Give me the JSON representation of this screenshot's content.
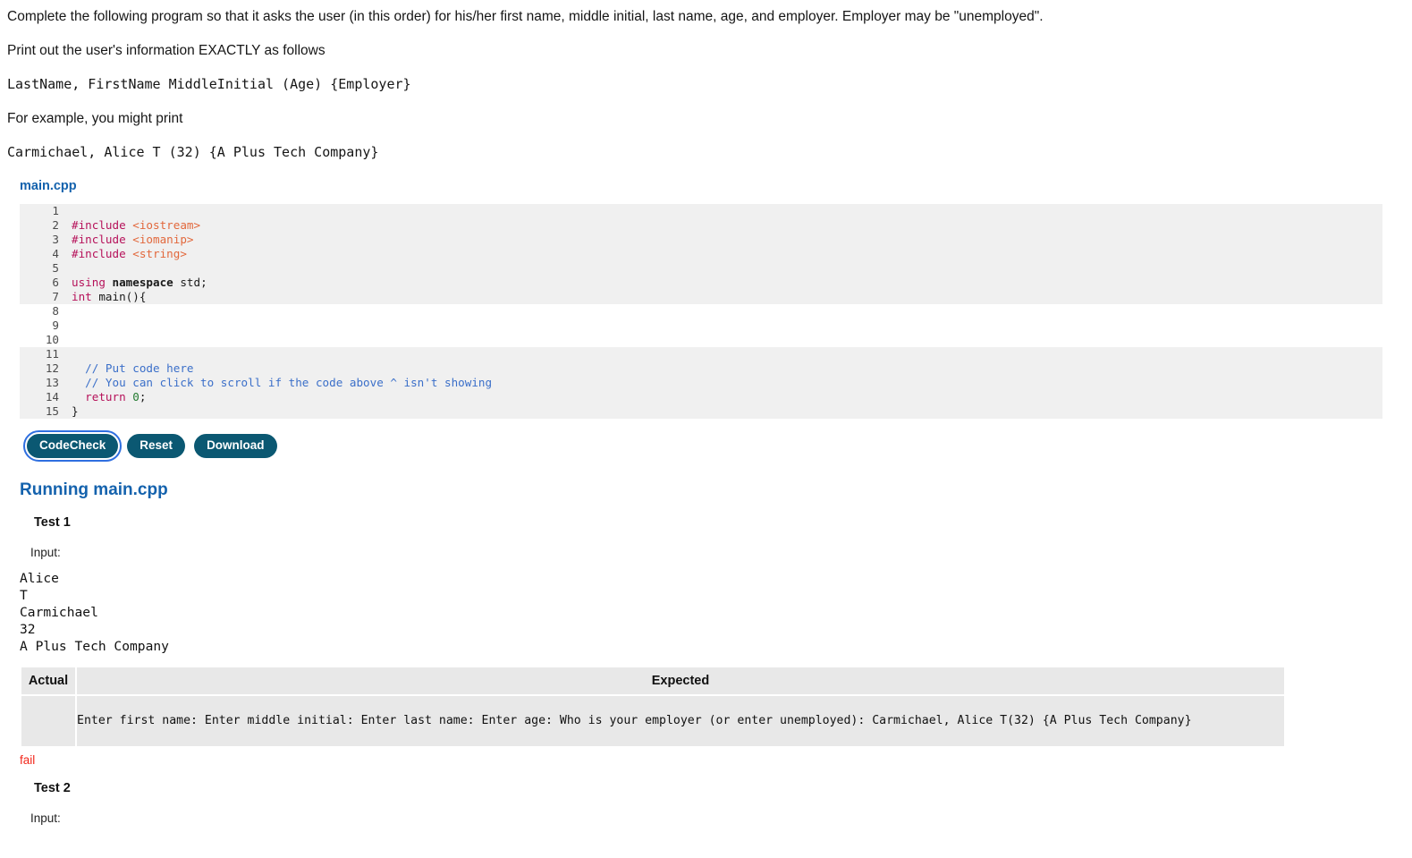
{
  "problem": {
    "lines": [
      {
        "text": "Complete the following program so that it asks the user (in this order) for his/her first name, middle initial, last name, age, and employer. Employer may be \"unemployed\".",
        "mono": false
      },
      {
        "text": "Print out the user's information EXACTLY as follows",
        "mono": false
      },
      {
        "text": "LastName, FirstName MiddleInitial (Age) {Employer}",
        "mono": true
      },
      {
        "text": "For example, you might print",
        "mono": false
      },
      {
        "text": "Carmichael, Alice T (32) {A Plus Tech Company}",
        "mono": true
      }
    ]
  },
  "editor": {
    "filename": "main.cpp",
    "segments": [
      {
        "editable": false,
        "lines": [
          {
            "n": "1",
            "tokens": []
          },
          {
            "n": "2",
            "tokens": [
              {
                "t": "#include ",
                "c": "pre"
              },
              {
                "t": "<iostream>",
                "c": "inc"
              }
            ]
          },
          {
            "n": "3",
            "tokens": [
              {
                "t": "#include ",
                "c": "pre"
              },
              {
                "t": "<iomanip>",
                "c": "inc"
              }
            ]
          },
          {
            "n": "4",
            "tokens": [
              {
                "t": "#include ",
                "c": "pre"
              },
              {
                "t": "<string>",
                "c": "inc"
              }
            ]
          },
          {
            "n": "5",
            "tokens": []
          },
          {
            "n": "6",
            "tokens": [
              {
                "t": "using ",
                "c": "kw"
              },
              {
                "t": "namespace",
                "c": "bold"
              },
              {
                "t": " std;",
                "c": "plain"
              }
            ]
          },
          {
            "n": "7",
            "tokens": [
              {
                "t": "int",
                "c": "kw"
              },
              {
                "t": " main(){",
                "c": "plain"
              }
            ]
          }
        ]
      },
      {
        "editable": true,
        "lines": [
          {
            "n": "8",
            "tokens": []
          },
          {
            "n": "9",
            "tokens": []
          },
          {
            "n": "10",
            "tokens": []
          }
        ]
      },
      {
        "editable": false,
        "lines": [
          {
            "n": "11",
            "tokens": []
          },
          {
            "n": "12",
            "tokens": [
              {
                "t": "  // Put code here",
                "c": "com"
              }
            ]
          },
          {
            "n": "13",
            "tokens": [
              {
                "t": "  // You can click to scroll if the code above ^ isn't showing",
                "c": "com"
              }
            ]
          },
          {
            "n": "14",
            "tokens": [
              {
                "t": "  return",
                "c": "kw"
              },
              {
                "t": " ",
                "c": "plain"
              },
              {
                "t": "0",
                "c": "num"
              },
              {
                "t": ";",
                "c": "plain"
              }
            ]
          },
          {
            "n": "15",
            "tokens": [
              {
                "t": "}",
                "c": "plain"
              }
            ]
          }
        ]
      }
    ]
  },
  "toolbar": {
    "codecheck_label": "CodeCheck",
    "reset_label": "Reset",
    "download_label": "Download"
  },
  "results": {
    "run_title": "Running main.cpp",
    "input_label": "Input:",
    "columns": {
      "actual": "Actual",
      "expected": "Expected"
    },
    "tests": [
      {
        "name": "Test 1",
        "input": "Alice\nT\nCarmichael\n32\nA Plus Tech Company",
        "actual": "",
        "expected": "Enter first name: Enter middle initial: Enter last name: Enter age: Who is your employer (or enter unemployed): Carmichael, Alice T(32) {A Plus Tech Company}",
        "verdict": "fail"
      },
      {
        "name": "Test 2",
        "input": ""
      }
    ]
  },
  "colors": {
    "accent_blue": "#1462ad",
    "button_bg": "#0b5872",
    "fail_red": "#f2261a",
    "focus_ring": "#2f6fe0"
  }
}
